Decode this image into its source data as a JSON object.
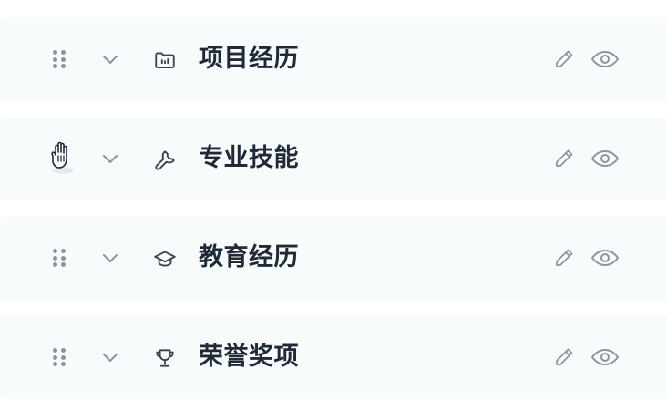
{
  "sections": [
    {
      "title": "项目经历",
      "icon": "folder-chart-icon",
      "dragging": false
    },
    {
      "title": "专业技能",
      "icon": "wrench-icon",
      "dragging": true
    },
    {
      "title": "教育经历",
      "icon": "graduation-cap-icon",
      "dragging": false
    },
    {
      "title": "荣誉奖项",
      "icon": "trophy-icon",
      "dragging": false
    }
  ],
  "controls": {
    "drag_icon": "drag-handle-icon",
    "toggle_icon": "chevron-down-icon",
    "edit_icon": "pencil-icon",
    "visibility_icon": "eye-icon"
  },
  "colors": {
    "row_background": "#f7fbfc",
    "title_text": "#1f2937",
    "icon_gray": "#8e949c",
    "section_icon": "#374151"
  }
}
